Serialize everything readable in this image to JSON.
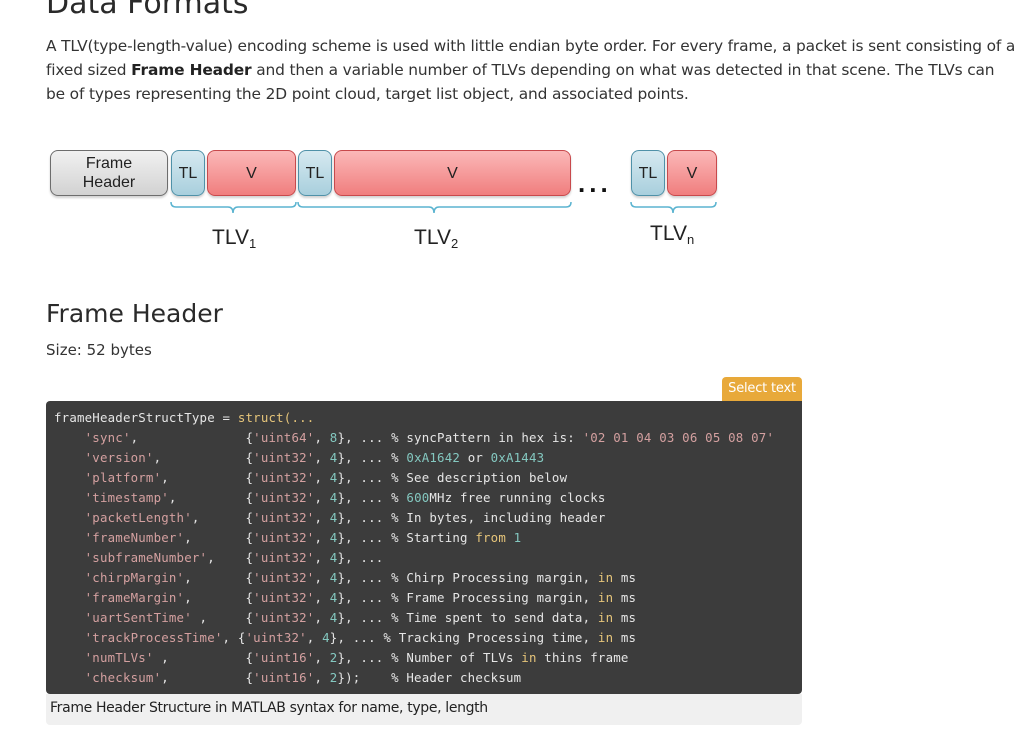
{
  "page": {
    "section_title": "Data Formats",
    "intro": {
      "part1": "A TLV(type-length-value) encoding scheme is used with little endian byte order. For every frame, a packet is sent consisting of a fixed sized ",
      "bold": "Frame Header",
      "part2": " and then a variable number of TLVs depending on what was detected in that scene. The TLVs can be of types representing the 2D point cloud, target list object, and associated points."
    }
  },
  "diagram": {
    "frame_header_line1": "Frame",
    "frame_header_line2": "Header",
    "tl_label": "TL",
    "v_label": "V",
    "ellipsis": "...",
    "tlv_base": "TLV",
    "tlv1_sub": "1",
    "tlv2_sub": "2",
    "tlvn_sub": "n",
    "colors": {
      "frame_header": "#d2d2d2",
      "tl": "#a8cfdd",
      "v": "#f07e7e",
      "brace": "#5bb4d0"
    }
  },
  "frame_header": {
    "title": "Frame Header",
    "size": "Size: 52 bytes",
    "select_text_button": "Select text",
    "caption": "Frame Header Structure in MATLAB syntax for name, type, length",
    "code": {
      "first_line": {
        "name": "frameHeaderStructType",
        "eq": " = ",
        "fn": "struct(..."
      },
      "fields": [
        {
          "name": "'sync'",
          "pad": ",              ",
          "type": "'uint64'",
          "size": "8",
          "tail": "}, ... ",
          "comment": [
            {
              "t": "% syncPattern ",
              "c": "cmt"
            },
            {
              "t": "in",
              "c": "cmt"
            },
            {
              "t": " hex is: ",
              "c": "cmt"
            },
            {
              "t": "'02 01 04 03 06 05 08 07'",
              "c": "str"
            }
          ]
        },
        {
          "name": "'version'",
          "pad": ",           ",
          "type": "'uint32'",
          "size": "4",
          "tail": "}, ... ",
          "comment": [
            {
              "t": "% ",
              "c": "cmt"
            },
            {
              "t": "0xA1642",
              "c": "num"
            },
            {
              "t": " or ",
              "c": "cmt"
            },
            {
              "t": "0xA1443",
              "c": "num"
            }
          ]
        },
        {
          "name": "'platform'",
          "pad": ",          ",
          "type": "'uint32'",
          "size": "4",
          "tail": "}, ... ",
          "comment": [
            {
              "t": "% See description below",
              "c": "cmt"
            }
          ]
        },
        {
          "name": "'timestamp'",
          "pad": ",         ",
          "type": "'uint32'",
          "size": "4",
          "tail": "}, ... ",
          "comment": [
            {
              "t": "% ",
              "c": "cmt"
            },
            {
              "t": "600",
              "c": "num"
            },
            {
              "t": "MHz free running clocks",
              "c": "cmt"
            }
          ]
        },
        {
          "name": "'packetLength'",
          "pad": ",      ",
          "type": "'uint32'",
          "size": "4",
          "tail": "}, ... ",
          "comment": [
            {
              "t": "% In bytes, including header",
              "c": "cmt"
            }
          ]
        },
        {
          "name": "'frameNumber'",
          "pad": ",       ",
          "type": "'uint32'",
          "size": "4",
          "tail": "}, ... ",
          "comment": [
            {
              "t": "% Starting ",
              "c": "cmt"
            },
            {
              "t": "from",
              "c": "kw"
            },
            {
              "t": " ",
              "c": "cmt"
            },
            {
              "t": "1",
              "c": "num"
            }
          ]
        },
        {
          "name": "'subframeNumber'",
          "pad": ",    ",
          "type": "'uint32'",
          "size": "4",
          "tail": "}, ...",
          "comment": []
        },
        {
          "name": "'chirpMargin'",
          "pad": ",       ",
          "type": "'uint32'",
          "size": "4",
          "tail": "}, ... ",
          "comment": [
            {
              "t": "% Chirp Processing margin, ",
              "c": "cmt"
            },
            {
              "t": "in",
              "c": "kw"
            },
            {
              "t": " ms",
              "c": "cmt"
            }
          ]
        },
        {
          "name": "'frameMargin'",
          "pad": ",       ",
          "type": "'uint32'",
          "size": "4",
          "tail": "}, ... ",
          "comment": [
            {
              "t": "% Frame Processing margin, ",
              "c": "cmt"
            },
            {
              "t": "in",
              "c": "kw"
            },
            {
              "t": " ms",
              "c": "cmt"
            }
          ]
        },
        {
          "name": "'uartSentTime'",
          "pad": " ,     ",
          "type": "'uint32'",
          "size": "4",
          "tail": "}, ... ",
          "comment": [
            {
              "t": "% Time spent to send data, ",
              "c": "cmt"
            },
            {
              "t": "in",
              "c": "kw"
            },
            {
              "t": " ms",
              "c": "cmt"
            }
          ]
        },
        {
          "name": "'trackProcessTime'",
          "pad": ", ",
          "type": "'uint32'",
          "size": "4",
          "tail": "}, ... ",
          "comment": [
            {
              "t": "% Tracking Processing time, ",
              "c": "cmt"
            },
            {
              "t": "in",
              "c": "kw"
            },
            {
              "t": " ms",
              "c": "cmt"
            }
          ]
        },
        {
          "name": "'numTLVs'",
          "pad": " ,          ",
          "type": "'uint16'",
          "size": "2",
          "tail": "}, ... ",
          "comment": [
            {
              "t": "% Number of TLVs ",
              "c": "cmt"
            },
            {
              "t": "in",
              "c": "kw"
            },
            {
              "t": " thins frame",
              "c": "cmt"
            }
          ]
        },
        {
          "name": "'checksum'",
          "pad": ",          ",
          "type": "'uint16'",
          "size": "2",
          "tail": "});    ",
          "comment": [
            {
              "t": "% Header checksum",
              "c": "cmt"
            }
          ]
        }
      ]
    }
  }
}
